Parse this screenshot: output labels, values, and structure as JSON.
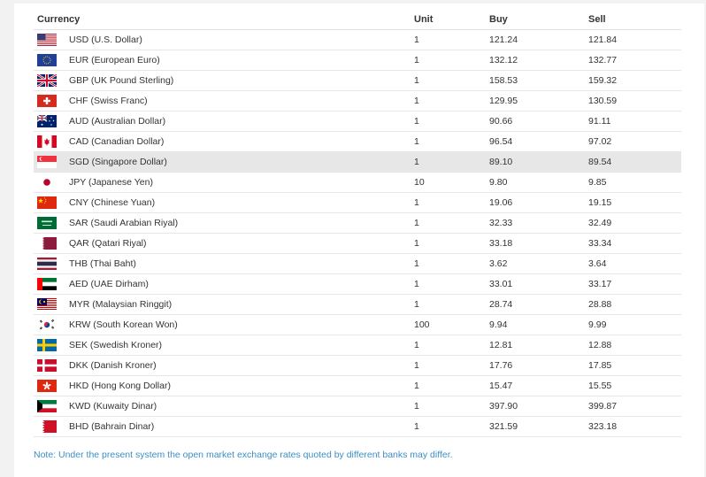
{
  "table": {
    "headers": {
      "currency": "Currency",
      "unit": "Unit",
      "buy": "Buy",
      "sell": "Sell"
    },
    "rows": [
      {
        "flag": "us-flag-icon",
        "name": "USD (U.S. Dollar)",
        "unit": "1",
        "buy": "121.24",
        "sell": "121.84"
      },
      {
        "flag": "eu-flag-icon",
        "name": "EUR (European Euro)",
        "unit": "1",
        "buy": "132.12",
        "sell": "132.77"
      },
      {
        "flag": "gb-flag-icon",
        "name": "GBP (UK Pound Sterling)",
        "unit": "1",
        "buy": "158.53",
        "sell": "159.32"
      },
      {
        "flag": "ch-flag-icon",
        "name": "CHF (Swiss Franc)",
        "unit": "1",
        "buy": "129.95",
        "sell": "130.59"
      },
      {
        "flag": "au-flag-icon",
        "name": "AUD (Australian Dollar)",
        "unit": "1",
        "buy": "90.66",
        "sell": "91.11"
      },
      {
        "flag": "ca-flag-icon",
        "name": "CAD (Canadian Dollar)",
        "unit": "1",
        "buy": "96.54",
        "sell": "97.02"
      },
      {
        "flag": "sg-flag-icon",
        "name": "SGD (Singapore Dollar)",
        "unit": "1",
        "buy": "89.10",
        "sell": "89.54"
      },
      {
        "flag": "jp-flag-icon",
        "name": "JPY (Japanese Yen)",
        "unit": "10",
        "buy": "9.80",
        "sell": "9.85"
      },
      {
        "flag": "cn-flag-icon",
        "name": "CNY (Chinese Yuan)",
        "unit": "1",
        "buy": "19.06",
        "sell": "19.15"
      },
      {
        "flag": "sa-flag-icon",
        "name": "SAR (Saudi Arabian Riyal)",
        "unit": "1",
        "buy": "32.33",
        "sell": "32.49"
      },
      {
        "flag": "qa-flag-icon",
        "name": "QAR (Qatari Riyal)",
        "unit": "1",
        "buy": "33.18",
        "sell": "33.34"
      },
      {
        "flag": "th-flag-icon",
        "name": "THB (Thai Baht)",
        "unit": "1",
        "buy": "3.62",
        "sell": "3.64"
      },
      {
        "flag": "ae-flag-icon",
        "name": "AED (UAE Dirham)",
        "unit": "1",
        "buy": "33.01",
        "sell": "33.17"
      },
      {
        "flag": "my-flag-icon",
        "name": "MYR (Malaysian Ringgit)",
        "unit": "1",
        "buy": "28.74",
        "sell": "28.88"
      },
      {
        "flag": "kr-flag-icon",
        "name": "KRW (South Korean Won)",
        "unit": "100",
        "buy": "9.94",
        "sell": "9.99"
      },
      {
        "flag": "se-flag-icon",
        "name": "SEK (Swedish Kroner)",
        "unit": "1",
        "buy": "12.81",
        "sell": "12.88"
      },
      {
        "flag": "dk-flag-icon",
        "name": "DKK (Danish Kroner)",
        "unit": "1",
        "buy": "17.76",
        "sell": "17.85"
      },
      {
        "flag": "hk-flag-icon",
        "name": "HKD (Hong Kong Dollar)",
        "unit": "1",
        "buy": "15.47",
        "sell": "15.55"
      },
      {
        "flag": "kw-flag-icon",
        "name": "KWD (Kuwaity Dinar)",
        "unit": "1",
        "buy": "397.90",
        "sell": "399.87"
      },
      {
        "flag": "bh-flag-icon",
        "name": "BHD (Bahrain Dinar)",
        "unit": "1",
        "buy": "321.59",
        "sell": "323.18"
      }
    ],
    "highlighted_row": 6
  },
  "note": "Note: Under the present system the open market exchange rates quoted by different banks may differ.",
  "colors": {
    "note": "#3a8fc4",
    "row_highlight": "#e7e7e7",
    "divider": "#e6e6e6"
  }
}
